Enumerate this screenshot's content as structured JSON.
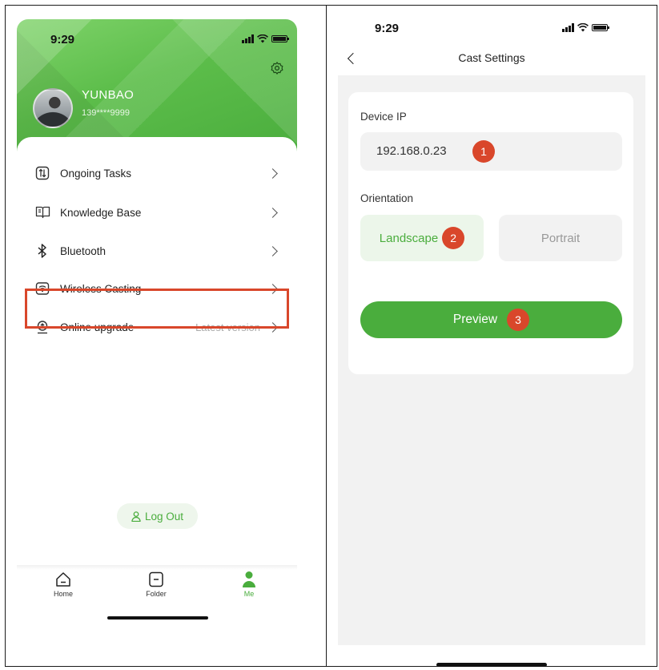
{
  "left": {
    "status_time": "9:29",
    "user": {
      "name": "YUNBAO",
      "phone": "139****9999"
    },
    "menu": [
      {
        "label": "Ongoing Tasks",
        "icon": "tasks-icon",
        "right": ""
      },
      {
        "label": "Knowledge Base",
        "icon": "book-icon",
        "right": ""
      },
      {
        "label": "Bluetooth",
        "icon": "bluetooth-icon",
        "right": ""
      },
      {
        "label": "Wireless Casting",
        "icon": "casting-icon",
        "right": "",
        "highlighted": true
      },
      {
        "label": "Online upgrade",
        "icon": "upgrade-icon",
        "right": "Latest version"
      }
    ],
    "logout_label": "Log Out",
    "tabs": [
      {
        "label": "Home",
        "icon": "home-icon",
        "active": false
      },
      {
        "label": "Folder",
        "icon": "folder-icon",
        "active": false
      },
      {
        "label": "Me",
        "icon": "person-icon",
        "active": true
      }
    ]
  },
  "right": {
    "status_time": "9:29",
    "title": "Cast Settings",
    "device_ip_label": "Device IP",
    "device_ip_value": "192.168.0.23",
    "orientation_label": "Orientation",
    "orientation_options": [
      "Landscape",
      "Portrait"
    ],
    "selected_orientation": "Landscape",
    "preview_label": "Preview",
    "step_badges": [
      "1",
      "2",
      "3"
    ]
  },
  "colors": {
    "brand_green": "#4aad3d",
    "highlight_red": "#d9472b",
    "light_green_bg": "#ecf6ea",
    "page_gray": "#f2f2f2"
  }
}
